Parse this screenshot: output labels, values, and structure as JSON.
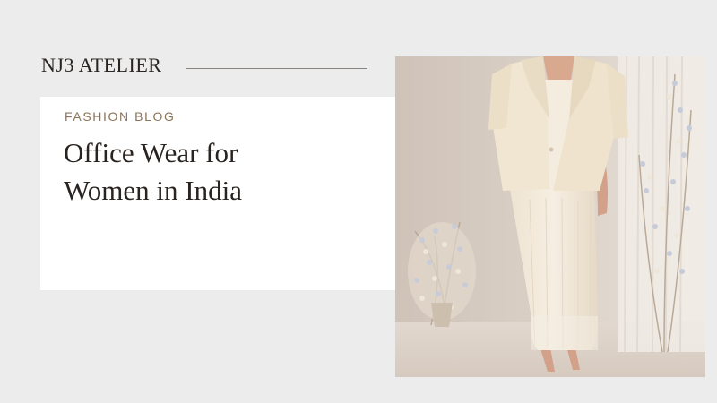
{
  "brand": {
    "name": "NJ3 ATELIER"
  },
  "card": {
    "kicker": "FASHION BLOG",
    "title_line1": "Office Wear for",
    "title_line2": "Women in India"
  },
  "photo": {
    "subject": "woman in cream blazer and midi skirt"
  },
  "colors": {
    "background": "#ececec",
    "card": "#ffffff",
    "kicker": "#8c7459",
    "text": "#2a2420"
  }
}
